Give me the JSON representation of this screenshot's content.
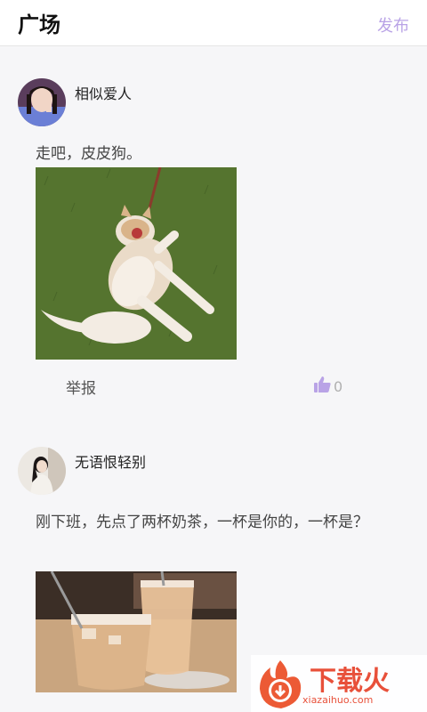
{
  "header": {
    "title": "广场",
    "publish_label": "发布"
  },
  "posts": [
    {
      "username": "相似爱人",
      "content": "走吧，皮皮狗。",
      "report_label": "举报",
      "like_count": "0"
    },
    {
      "username": "无语恨轻别",
      "content": "刚下班，先点了两杯奶茶，一杯是你的，一杯是？"
    }
  ],
  "watermark": {
    "brand": "下载火",
    "site": "xiazaihuo.com"
  },
  "colors": {
    "accent": "#b9a3e6",
    "watermark": "#e8503a"
  }
}
